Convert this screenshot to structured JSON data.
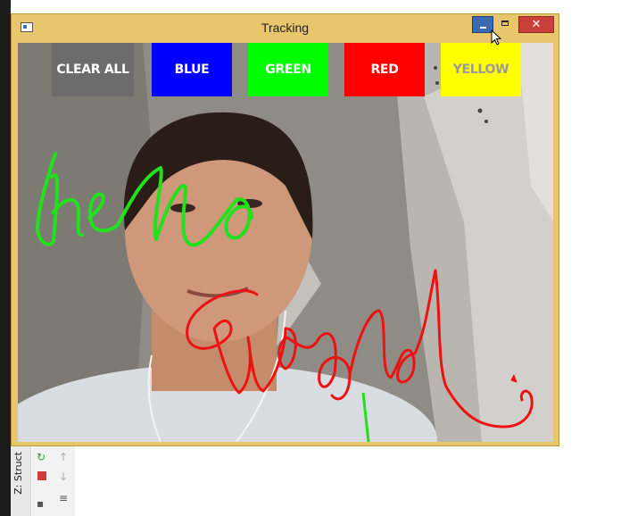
{
  "window": {
    "title": "Tracking",
    "close_glyph": "✕",
    "controls": [
      "minimize-icon",
      "maximize-icon",
      "close-icon"
    ]
  },
  "toolbar": {
    "buttons": [
      {
        "label": "CLEAR ALL",
        "color": "#6c6c6c"
      },
      {
        "label": "BLUE",
        "color": "#0000ff"
      },
      {
        "label": "GREEN",
        "color": "#00ff00"
      },
      {
        "label": "RED",
        "color": "#ff0000"
      },
      {
        "label": "YELLOW",
        "color": "#ffff00"
      }
    ]
  },
  "ide": {
    "structure_label": "Z: Struct"
  },
  "strokes": {
    "green": "#22e01c",
    "red": "#ee1111"
  }
}
